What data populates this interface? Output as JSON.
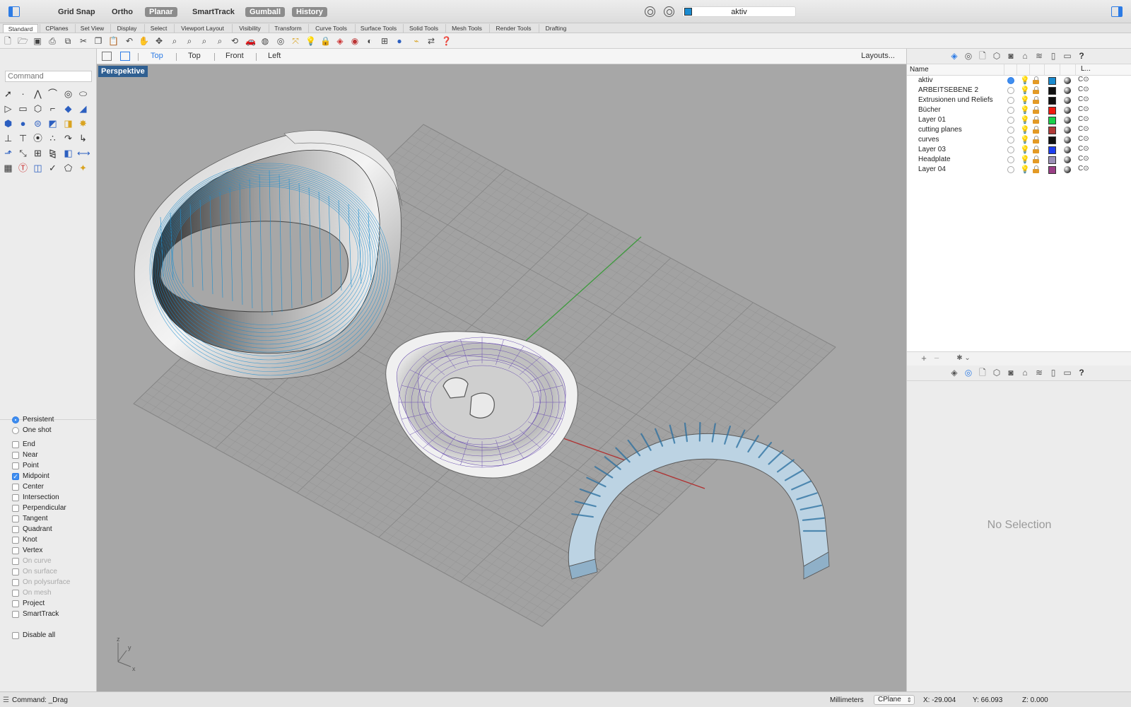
{
  "topbar": {
    "modes": [
      {
        "label": "Grid Snap",
        "on": false
      },
      {
        "label": "Ortho",
        "on": false
      },
      {
        "label": "Planar",
        "on": true
      },
      {
        "label": "SmartTrack",
        "on": false
      },
      {
        "label": "Gumball",
        "on": true
      },
      {
        "label": "History",
        "on": true
      }
    ],
    "current_layer": "aktiv",
    "current_layer_color": "#1a8bd0"
  },
  "tabs": [
    "Standard",
    "CPlanes",
    "Set View",
    "Display",
    "Select",
    "Viewport Layout",
    "Visibility",
    "Transform",
    "Curve Tools",
    "Surface Tools",
    "Solid Tools",
    "Mesh Tools",
    "Render Tools",
    "Drafting"
  ],
  "left_panel": {
    "command_placeholder": "Command",
    "snap_mode": [
      {
        "label": "Persistent",
        "selected": true
      },
      {
        "label": "One shot",
        "selected": false
      }
    ],
    "osnaps": [
      {
        "label": "End",
        "checked": false,
        "enabled": true
      },
      {
        "label": "Near",
        "checked": false,
        "enabled": true
      },
      {
        "label": "Point",
        "checked": false,
        "enabled": true
      },
      {
        "label": "Midpoint",
        "checked": true,
        "enabled": true
      },
      {
        "label": "Center",
        "checked": false,
        "enabled": true
      },
      {
        "label": "Intersection",
        "checked": false,
        "enabled": true
      },
      {
        "label": "Perpendicular",
        "checked": false,
        "enabled": true
      },
      {
        "label": "Tangent",
        "checked": false,
        "enabled": true
      },
      {
        "label": "Quadrant",
        "checked": false,
        "enabled": true
      },
      {
        "label": "Knot",
        "checked": false,
        "enabled": true
      },
      {
        "label": "Vertex",
        "checked": false,
        "enabled": true
      },
      {
        "label": "On curve",
        "checked": false,
        "enabled": false
      },
      {
        "label": "On surface",
        "checked": false,
        "enabled": false
      },
      {
        "label": "On polysurface",
        "checked": false,
        "enabled": false
      },
      {
        "label": "On mesh",
        "checked": false,
        "enabled": false
      },
      {
        "label": "Project",
        "checked": false,
        "enabled": true
      },
      {
        "label": "SmartTrack",
        "checked": false,
        "enabled": true
      }
    ],
    "disable_all": "Disable all"
  },
  "viewport_tabs": {
    "tabs": [
      {
        "label": "Top",
        "active": true
      },
      {
        "label": "Top",
        "active": false
      },
      {
        "label": "Front",
        "active": false
      },
      {
        "label": "Left",
        "active": false
      }
    ],
    "layouts_label": "Layouts..."
  },
  "viewport": {
    "label": "Perspektive",
    "axis_labels": {
      "z": "z",
      "y": "y",
      "x": "x"
    },
    "colors": {
      "background": "#a7a7a7",
      "grid": "#8e8e8e",
      "x_axis": "#b03030",
      "y_axis": "#3c9a3c",
      "isocurves": "#1e8fd0",
      "headplate_iso": "#6a4fb0"
    }
  },
  "layers_panel": {
    "header_name": "Name",
    "header_l": "L...",
    "layers": [
      {
        "name": "aktiv",
        "current": true,
        "bulb_on": true,
        "color": "#1a8bd0",
        "print": "C⊙"
      },
      {
        "name": "ARBEITSEBENE 2",
        "current": false,
        "bulb_on": false,
        "color": "#111111",
        "print": "C⊙"
      },
      {
        "name": "Extrusionen und Reliefs",
        "current": false,
        "bulb_on": false,
        "color": "#111111",
        "print": "C⊙"
      },
      {
        "name": "Bücher",
        "current": false,
        "bulb_on": false,
        "color": "#f21a10",
        "print": "C⊙"
      },
      {
        "name": "Layer 01",
        "current": false,
        "bulb_on": false,
        "color": "#19d14a",
        "print": "C⊙"
      },
      {
        "name": "cutting planes",
        "current": false,
        "bulb_on": false,
        "color": "#b03a38",
        "print": "C⊙"
      },
      {
        "name": "curves",
        "current": false,
        "bulb_on": false,
        "color": "#111111",
        "print": "C⊙"
      },
      {
        "name": "Layer 03",
        "current": false,
        "bulb_on": false,
        "color": "#1d3ef0",
        "print": "C⊙"
      },
      {
        "name": "Headplate",
        "current": false,
        "bulb_on": true,
        "color": "#9a8fb6",
        "print": "C⊙"
      },
      {
        "name": "Layer 04",
        "current": false,
        "bulb_on": false,
        "color": "#9a3f86",
        "print": "C⊙"
      }
    ],
    "add_label": "+",
    "remove_label": "−",
    "gear_label": "✱ ⌄"
  },
  "properties_panel": {
    "empty_text": "No Selection"
  },
  "statusbar": {
    "command": "Command: _Drag",
    "units": "Millimeters",
    "cplane": "CPlane",
    "x": "X: -29.004",
    "y": "Y: 66.093",
    "z": "Z: 0.000"
  }
}
